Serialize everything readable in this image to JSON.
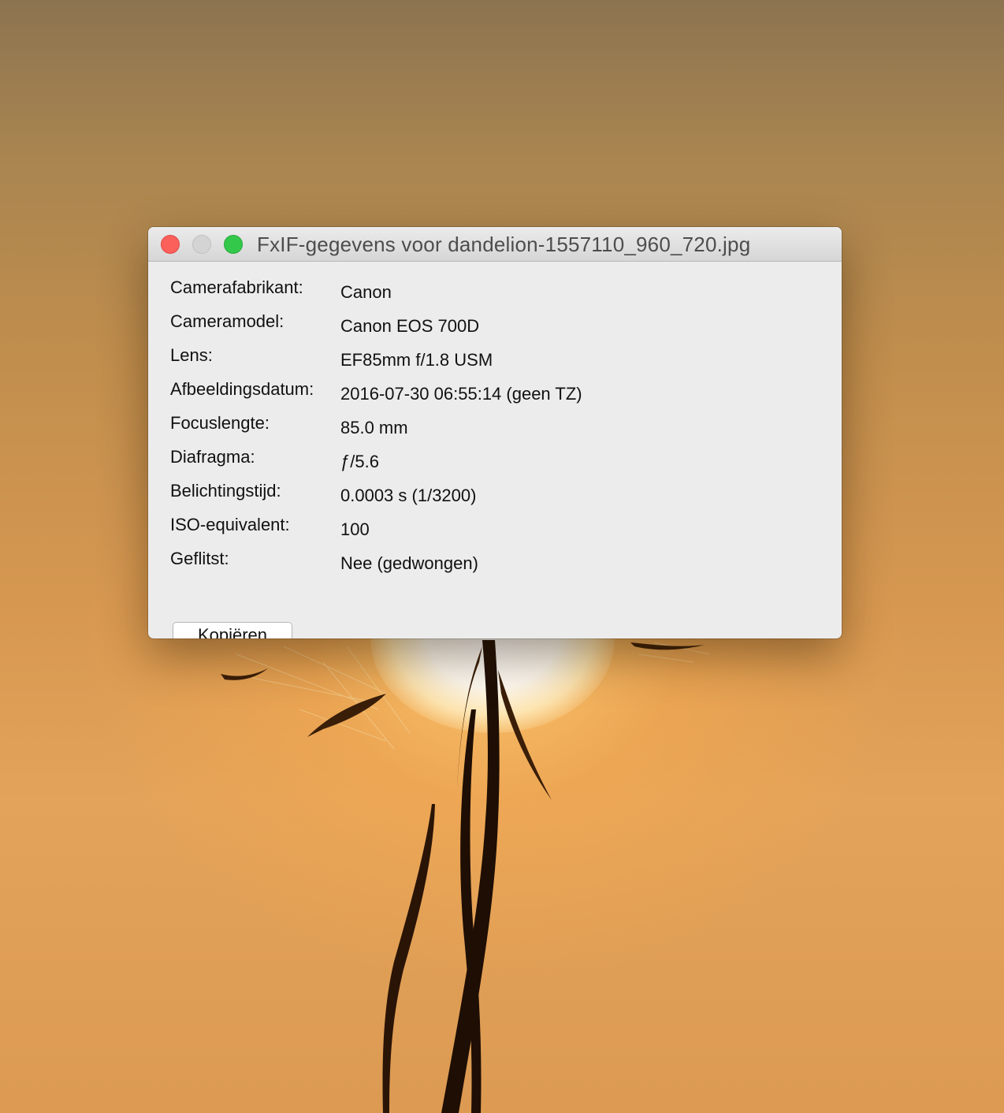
{
  "window": {
    "title": "FxIF-gegevens voor dandelion-1557110_960_720.jpg"
  },
  "exif": {
    "rows": [
      {
        "label": "Camerafabrikant:",
        "value": "Canon"
      },
      {
        "label": "Cameramodel:",
        "value": "Canon EOS 700D"
      },
      {
        "label": "Lens:",
        "value": "EF85mm f/1.8 USM"
      },
      {
        "label": "Afbeeldingsdatum:",
        "value": "2016-07-30 06:55:14 (geen TZ)"
      },
      {
        "label": "Focuslengte:",
        "value": "85.0 mm"
      },
      {
        "label": "Diafragma:",
        "value": "ƒ/5.6"
      },
      {
        "label": "Belichtingstijd:",
        "value": "0.0003 s (1/3200)"
      },
      {
        "label": "ISO-equivalent:",
        "value": "100"
      },
      {
        "label": "Geflitst:",
        "value": "Nee (gedwongen)"
      }
    ]
  },
  "actions": {
    "copy_label": "Kopiëren"
  },
  "colors": {
    "close": "#fc605b",
    "minimize": "#d4d4d4",
    "zoom": "#34c84a",
    "window_bg": "#ececec"
  }
}
